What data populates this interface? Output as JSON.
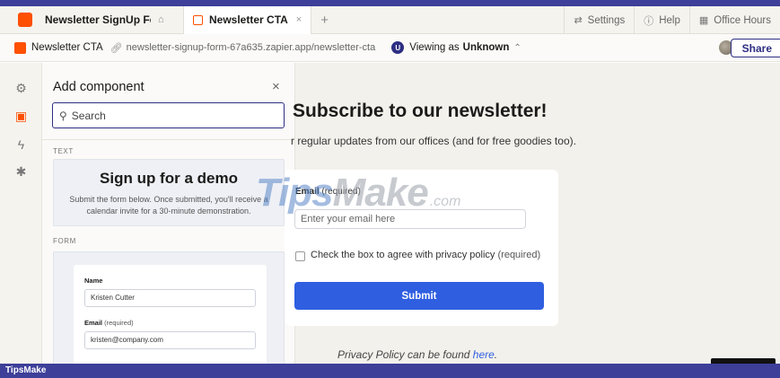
{
  "tabs": {
    "workspace_tab": "Newsletter SignUp Fo...",
    "active_tab": "Newsletter CTA",
    "close": "×",
    "add": "+",
    "settings": "Settings",
    "help": "Help",
    "office_hours": "Office Hours"
  },
  "urlbar": {
    "page_title": "Newsletter CTA",
    "url": "newsletter-signup-form-67a635.zapier.app/newsletter-cta",
    "viewing_prefix": "Viewing as",
    "viewing_as": "Unknown",
    "viewing_initial": "U",
    "share": "Share"
  },
  "panel": {
    "title": "Add component",
    "close": "×",
    "search_placeholder": "Search",
    "section_text": "TEXT",
    "section_form": "FORM",
    "text_card": {
      "heading": "Sign up for a demo",
      "body": "Submit the form below. Once submitted, you'll receive a calendar invite for a 30-minute demonstration."
    },
    "form_card": {
      "name_label": "Name",
      "name_value": "Kristen Cutter",
      "email_label": "Email",
      "email_req": "(required)",
      "email_value": "kristen@company.com"
    }
  },
  "main": {
    "title": "Subscribe to our newsletter!",
    "subtitle": "r regular updates from our offices (and for free goodies too).",
    "email_label": "Email",
    "email_req": "(required)",
    "email_placeholder": "Enter your email here",
    "checkbox_label": "Check the box to agree with privacy policy",
    "checkbox_req": "(required)",
    "submit": "Submit",
    "privacy_prefix": "Privacy Policy can be found",
    "privacy_link": "here",
    "privacy_suffix": "."
  },
  "watermark": {
    "part1": "Tips",
    "part2": "Make",
    "part3": ".com"
  },
  "footer": {
    "label": "TipsMake"
  },
  "colors": {
    "brand_orange": "#ff4f00",
    "accent_navy": "#2d2e83",
    "submit_blue": "#2f5fe0",
    "frame_purple": "#3d3f99"
  }
}
